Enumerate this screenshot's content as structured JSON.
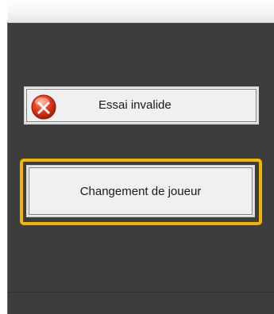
{
  "buttons": {
    "invalid_attempt": {
      "label": "Essai invalide",
      "icon": "error-x-icon"
    },
    "change_player": {
      "label": "Changement de joueur",
      "highlight_color": "#f5b400"
    }
  },
  "colors": {
    "panel_background": "#3d3d3d",
    "button_face": "#f0f0f0",
    "error_icon_red": "#d62a12",
    "highlight": "#f5b400"
  }
}
